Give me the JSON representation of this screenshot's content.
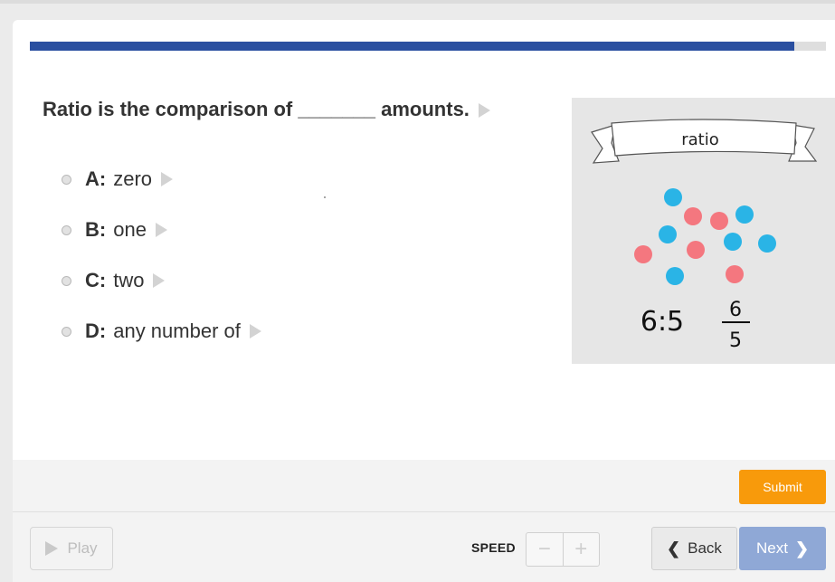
{
  "quiz": {
    "progress_percent": 96,
    "question": "Ratio is the comparison of _______ amounts.",
    "answers": [
      {
        "letter": "A:",
        "text": "zero"
      },
      {
        "letter": "B:",
        "text": "one"
      },
      {
        "letter": "C:",
        "text": "two"
      },
      {
        "letter": "D:",
        "text": "any number of"
      }
    ],
    "illustration": {
      "banner_label": "ratio",
      "ratio_text": "6:5",
      "fraction_numerator": "6",
      "fraction_denominator": "5",
      "colors": {
        "blue_dot": "#2ab4e6",
        "pink_dot": "#f4777f"
      }
    }
  },
  "controls": {
    "submit_label": "Submit",
    "play_label": "Play",
    "speed_label": "SPEED",
    "speed_minus": "−",
    "speed_plus": "+",
    "back_label": "Back",
    "next_label": "Next"
  },
  "colors": {
    "progress": "#2a4fa0",
    "submit": "#f89a0b",
    "next": "#8fa8d6"
  }
}
